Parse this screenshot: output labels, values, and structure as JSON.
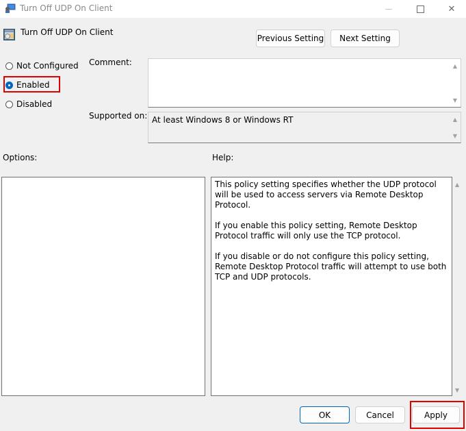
{
  "window": {
    "title": "Turn Off UDP On Client",
    "controls": {
      "minimize": "—",
      "maximize": "☐",
      "close": "✕"
    }
  },
  "header": {
    "title": "Turn Off UDP On Client",
    "previous_label": "Previous Setting",
    "next_label": "Next Setting"
  },
  "state": {
    "options": [
      {
        "label": "Not Configured",
        "checked": false
      },
      {
        "label": "Enabled",
        "checked": true
      },
      {
        "label": "Disabled",
        "checked": false
      }
    ]
  },
  "comment": {
    "label": "Comment:",
    "value": ""
  },
  "supported": {
    "label": "Supported on:",
    "value": "At least Windows 8 or Windows RT"
  },
  "options_panel": {
    "label": "Options:"
  },
  "help_panel": {
    "label": "Help:",
    "paragraphs": [
      "This policy setting specifies whether the UDP protocol will be used to access servers via Remote Desktop Protocol.",
      "If you enable this policy setting, Remote Desktop Protocol traffic will only use the TCP protocol.",
      "If you disable or do not configure this policy setting, Remote Desktop Protocol traffic will attempt to use both TCP and UDP protocols."
    ]
  },
  "footer": {
    "ok_label": "OK",
    "cancel_label": "Cancel",
    "apply_label": "Apply"
  },
  "colors": {
    "accent": "#0067c0",
    "highlight": "#e00000"
  }
}
